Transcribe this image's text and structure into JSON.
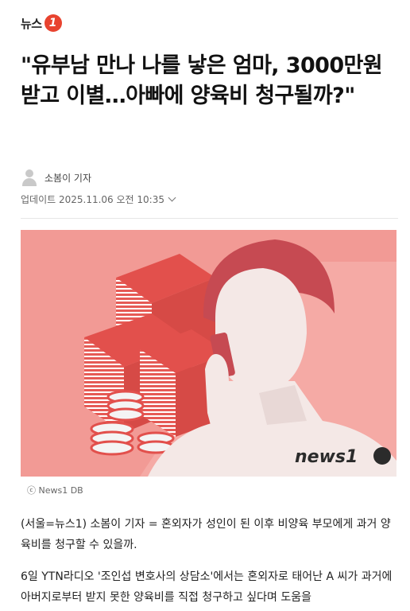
{
  "header": {
    "logo_text": "뉴스",
    "logo_mark": "1"
  },
  "article": {
    "title": "\"유부남 만나 나를 낳은 엄마, 3000만원 받고 이별…아빠에 양육비 청구될까?\"",
    "reporter": "소봄이 기자",
    "updated": "업데이트 2025.11.06 오전 10:35",
    "photo_watermark": "news1",
    "photo_caption": "ⓒ News1 DB",
    "paragraphs": [
      "(서울=뉴스1) 소봄이 기자 = 혼외자가 성인이 된 이후 비양육 부모에게 과거 양육비를 청구할 수 있을까.",
      "6일 YTN라디오 '조인섭 변호사의 상담소'에서는 혼외자로 태어난 A 씨가 과거에 아버지로부터 받지 못한 양육비를 직접 청구하고 싶다며 도움을"
    ]
  },
  "colors": {
    "brand": "#e8432f",
    "photo_bg": "#f29a95",
    "money": "#e2504c"
  },
  "icons": {
    "avatar": "person-icon",
    "dropdown": "chevron-down-icon"
  }
}
